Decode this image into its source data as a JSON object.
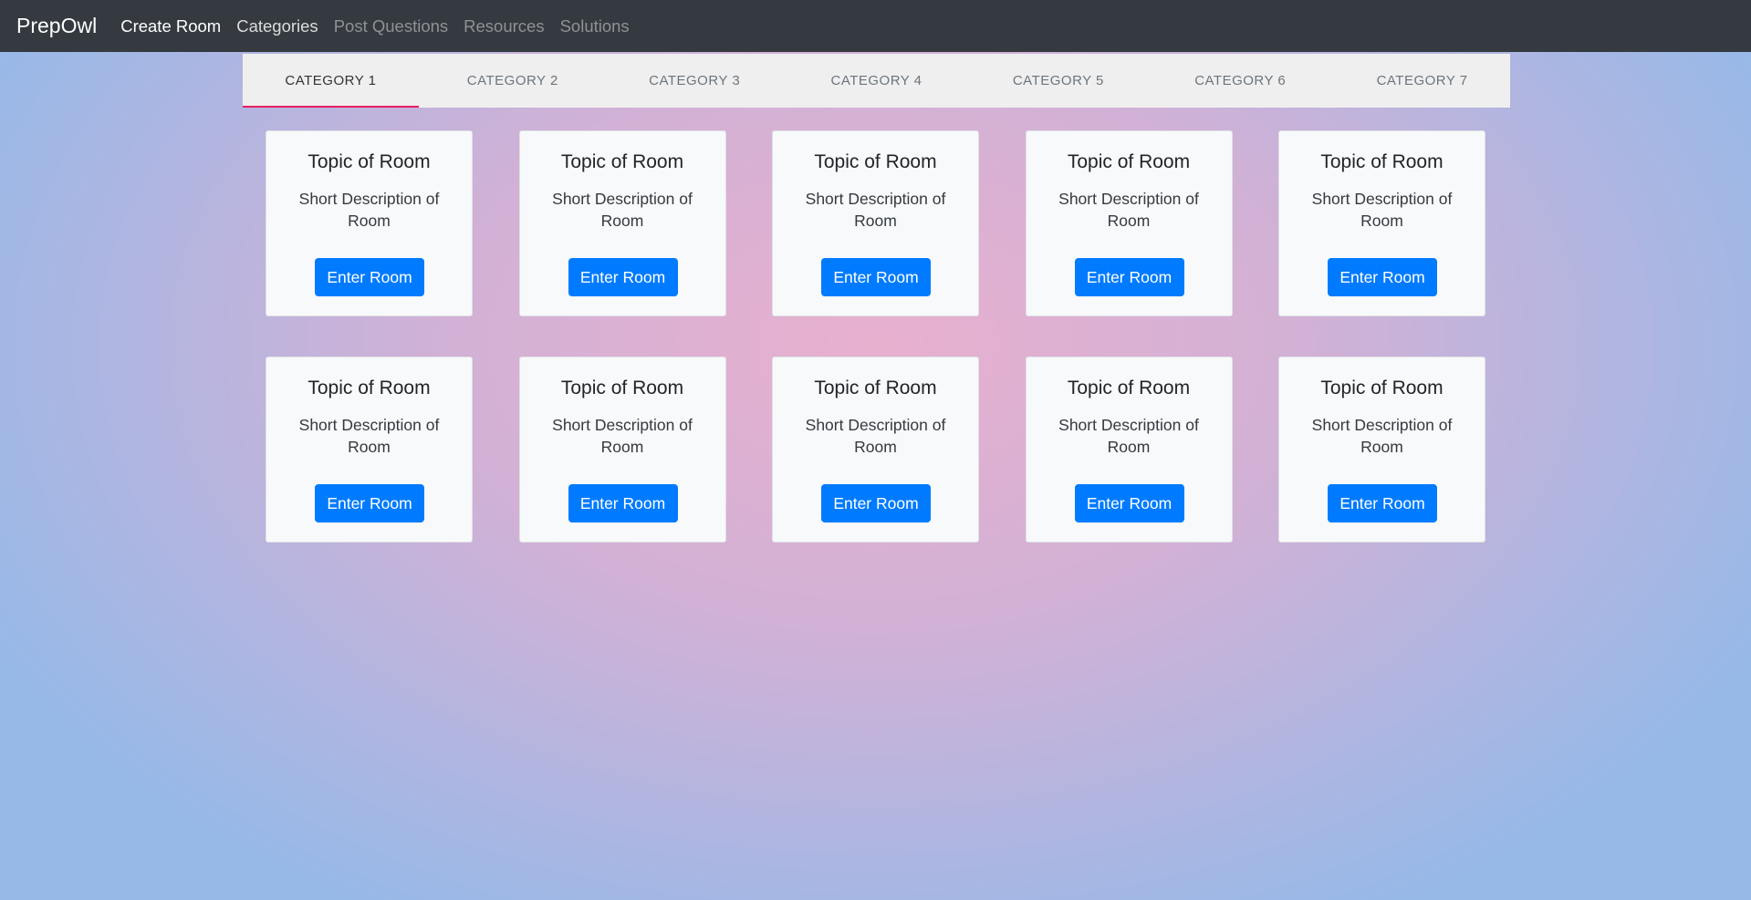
{
  "navbar": {
    "brand": "PrepOwl",
    "links": [
      {
        "label": "Create Room",
        "tone": "white"
      },
      {
        "label": "Categories",
        "tone": "light"
      },
      {
        "label": "Post Questions",
        "tone": "muted"
      },
      {
        "label": "Resources",
        "tone": "muted"
      },
      {
        "label": "Solutions",
        "tone": "muted"
      }
    ]
  },
  "tabs": {
    "active_index": 0,
    "items": [
      {
        "label": "CATEGORY 1"
      },
      {
        "label": "CATEGORY 2"
      },
      {
        "label": "CATEGORY 3"
      },
      {
        "label": "CATEGORY 4"
      },
      {
        "label": "CATEGORY 5"
      },
      {
        "label": "CATEGORY 6"
      },
      {
        "label": "CATEGORY 7"
      }
    ]
  },
  "rooms": [
    {
      "title": "Topic of Room",
      "description": "Short Description of Room",
      "button": "Enter Room"
    },
    {
      "title": "Topic of Room",
      "description": "Short Description of Room",
      "button": "Enter Room"
    },
    {
      "title": "Topic of Room",
      "description": "Short Description of Room",
      "button": "Enter Room"
    },
    {
      "title": "Topic of Room",
      "description": "Short Description of Room",
      "button": "Enter Room"
    },
    {
      "title": "Topic of Room",
      "description": "Short Description of Room",
      "button": "Enter Room"
    },
    {
      "title": "Topic of Room",
      "description": "Short Description of Room",
      "button": "Enter Room"
    },
    {
      "title": "Topic of Room",
      "description": "Short Description of Room",
      "button": "Enter Room"
    },
    {
      "title": "Topic of Room",
      "description": "Short Description of Room",
      "button": "Enter Room"
    },
    {
      "title": "Topic of Room",
      "description": "Short Description of Room",
      "button": "Enter Room"
    },
    {
      "title": "Topic of Room",
      "description": "Short Description of Room",
      "button": "Enter Room"
    }
  ],
  "colors": {
    "navbar_bg": "#343a40",
    "tab_active_underline": "#e91e63",
    "button_primary": "#007bff"
  }
}
